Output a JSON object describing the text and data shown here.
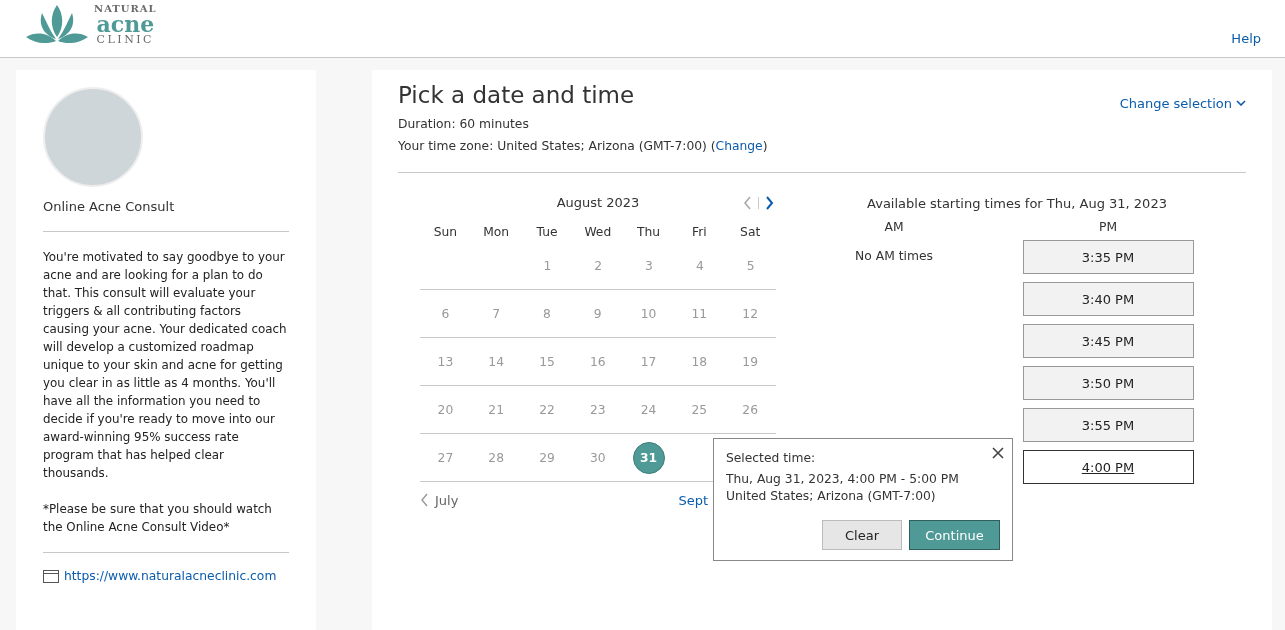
{
  "header": {
    "logo": {
      "top": "NATURAL",
      "middle": "acne",
      "bottom": "CLINIC"
    },
    "help": "Help"
  },
  "service": {
    "name": "Online Acne Consult",
    "description": "You're motivated to say goodbye to your acne and are looking for a plan to do that. This consult will evaluate your triggers & all contributing factors causing your acne. Your dedicated coach will develop a customized roadmap unique to your skin and acne for getting you clear in as little as 4 months. You'll have all the information you need to decide if you're ready to move into our award-winning 95% success rate program that has helped clear thousands.",
    "note": "*Please be sure that you should watch the Online Acne Consult Video*",
    "website": "https://www.naturalacneclinic.com"
  },
  "booking": {
    "title": "Pick a date and time",
    "duration": "Duration: 60 minutes",
    "timezone_label": "Your time zone: United States;  Arizona  (GMT-7:00)  (",
    "timezone_link": "Change",
    "timezone_end": ")",
    "change_selection": "Change selection",
    "calendar": {
      "month": "August 2023",
      "prev_enabled": false,
      "next_enabled": true,
      "weekdays": [
        "Sun",
        "Mon",
        "Tue",
        "Wed",
        "Thu",
        "Fri",
        "Sat"
      ],
      "weeks": [
        {
          "kind": "trailing",
          "days": [
            {
              "day": "1",
              "selected": false
            },
            {
              "day": "2",
              "selected": false
            },
            {
              "day": "3",
              "selected": false
            },
            {
              "day": "4",
              "selected": false
            },
            {
              "day": "5",
              "selected": false
            }
          ]
        },
        {
          "kind": "full",
          "days": [
            {
              "day": "6",
              "selected": false
            },
            {
              "day": "7",
              "selected": false
            },
            {
              "day": "8",
              "selected": false
            },
            {
              "day": "9",
              "selected": false
            },
            {
              "day": "10",
              "selected": false
            },
            {
              "day": "11",
              "selected": false
            },
            {
              "day": "12",
              "selected": false
            }
          ]
        },
        {
          "kind": "full",
          "days": [
            {
              "day": "13",
              "selected": false
            },
            {
              "day": "14",
              "selected": false
            },
            {
              "day": "15",
              "selected": false
            },
            {
              "day": "16",
              "selected": false
            },
            {
              "day": "17",
              "selected": false
            },
            {
              "day": "18",
              "selected": false
            },
            {
              "day": "19",
              "selected": false
            }
          ]
        },
        {
          "kind": "full",
          "days": [
            {
              "day": "20",
              "selected": false
            },
            {
              "day": "21",
              "selected": false
            },
            {
              "day": "22",
              "selected": false
            },
            {
              "day": "23",
              "selected": false
            },
            {
              "day": "24",
              "selected": false
            },
            {
              "day": "25",
              "selected": false
            },
            {
              "day": "26",
              "selected": false
            }
          ]
        },
        {
          "kind": "full",
          "days": [
            {
              "day": "27",
              "selected": false
            },
            {
              "day": "28",
              "selected": false
            },
            {
              "day": "29",
              "selected": false
            },
            {
              "day": "30",
              "selected": false
            },
            {
              "day": "31",
              "selected": true
            }
          ]
        }
      ],
      "prev_month": "July",
      "next_month": "Sept"
    },
    "times": {
      "heading": "Available starting times for Thu, Aug 31, 2023",
      "am_label": "AM",
      "pm_label": "PM",
      "am_empty": "No AM times",
      "pm": [
        {
          "time": "3:35 PM",
          "selected": false
        },
        {
          "time": "3:40 PM",
          "selected": false
        },
        {
          "time": "3:45 PM",
          "selected": false
        },
        {
          "time": "3:50 PM",
          "selected": false
        },
        {
          "time": "3:55 PM",
          "selected": false
        },
        {
          "time": "4:00 PM",
          "selected": true
        }
      ]
    },
    "popup": {
      "label": "Selected time:",
      "when": "Thu, Aug 31, 2023, 4:00 PM - 5:00 PM",
      "zone": "United States; Arizona (GMT-7:00)",
      "buttons": [
        {
          "label": "Clear",
          "kind": "secondary"
        },
        {
          "label": "Continue",
          "kind": "primary"
        }
      ]
    }
  }
}
